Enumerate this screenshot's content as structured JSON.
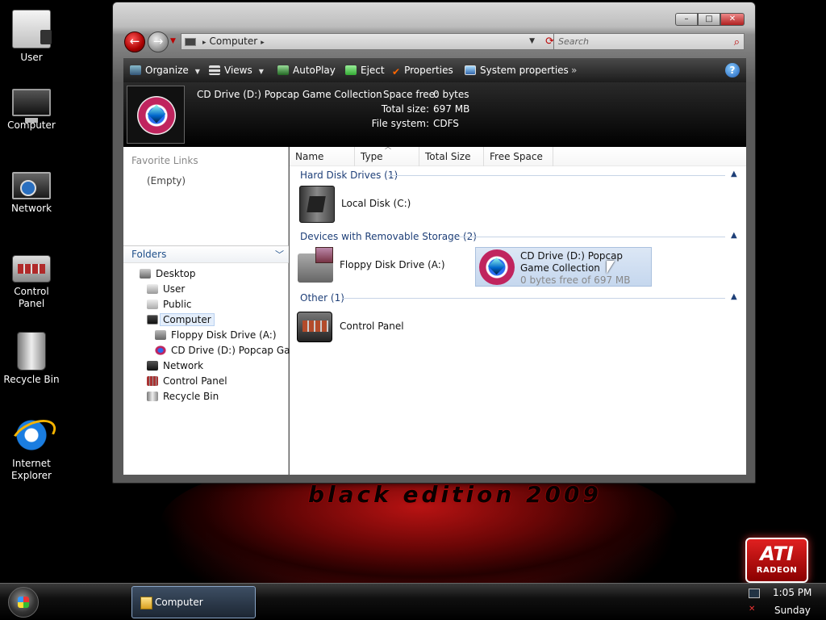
{
  "desktop": {
    "icons": [
      {
        "label": "User",
        "icon": "user-folder-icon"
      },
      {
        "label": "Computer",
        "icon": "computer-icon"
      },
      {
        "label": "Network",
        "icon": "network-icon"
      },
      {
        "label": "Control Panel",
        "icon": "control-panel-icon"
      },
      {
        "label": "Recycle Bin",
        "icon": "recycle-bin-icon"
      },
      {
        "label": "Internet Explorer",
        "icon": "internet-explorer-icon"
      }
    ],
    "ati": {
      "main": "ATI",
      "sub": "RADEON"
    }
  },
  "window": {
    "buttons": {
      "minimize": "–",
      "maximize": "□",
      "close": "✕"
    },
    "address": {
      "location": "Computer",
      "separator": "▸"
    },
    "search": {
      "placeholder": "Search"
    },
    "toolbar": {
      "organize": "Organize",
      "views": "Views",
      "autoplay": "AutoPlay",
      "eject": "Eject",
      "properties": "Properties",
      "system_properties": "System properties",
      "more": "»",
      "help": "?"
    },
    "details": {
      "name": "CD Drive (D:) Popcap Game Collection",
      "space_free_label": "Space free:",
      "space_free": "0 bytes",
      "total_size_label": "Total size:",
      "total_size": "697 MB",
      "file_system_label": "File system:",
      "file_system": "CDFS"
    },
    "left_pane": {
      "favorite_links": "Favorite Links",
      "empty": "(Empty)",
      "folders": "Folders",
      "tree": [
        {
          "label": "Desktop"
        },
        {
          "label": "User"
        },
        {
          "label": "Public"
        },
        {
          "label": "Computer"
        },
        {
          "label": "Floppy Disk Drive (A:)"
        },
        {
          "label": "CD Drive (D:) Popcap Game"
        },
        {
          "label": "Network"
        },
        {
          "label": "Control Panel"
        },
        {
          "label": "Recycle Bin"
        }
      ]
    },
    "columns": [
      "Name",
      "Type",
      "Total Size",
      "Free Space"
    ],
    "groups": [
      {
        "title": "Hard Disk Drives (1)",
        "items": [
          {
            "label": "Local Disk (C:)"
          }
        ]
      },
      {
        "title": "Devices with Removable Storage (2)",
        "items": [
          {
            "label": "Floppy Disk Drive (A:)"
          },
          {
            "label": "CD Drive (D:) Popcap Game Collection",
            "sub": "0 bytes free of 697 MB"
          }
        ]
      },
      {
        "title": "Other (1)",
        "items": [
          {
            "label": "Control Panel"
          }
        ]
      }
    ]
  },
  "taskbar": {
    "task": "Computer",
    "time": "1:05 PM",
    "day": "Sunday"
  },
  "colors": {
    "accent": "#1e3f78",
    "wallpaper_red": "#c21414"
  }
}
